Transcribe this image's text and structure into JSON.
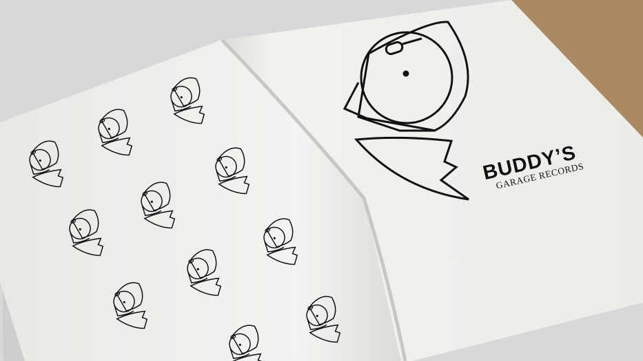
{
  "brand": {
    "name": "BUDDY’S",
    "tagline": "GARAGE RECORDS"
  },
  "colors": {
    "background": "#d8d8da",
    "paper": "#f2f1ee",
    "ink": "#111111",
    "cover_edge": "#9c7b55"
  },
  "sketches": [
    "dog-sketch",
    "dog-sketch",
    "dog-sketch",
    "dog-sketch",
    "dog-sketch",
    "dog-sketch",
    "dog-sketch",
    "dog-sketch",
    "dog-sketch",
    "dog-sketch",
    "dog-sketch",
    "dog-sketch",
    "dog-sketch"
  ]
}
